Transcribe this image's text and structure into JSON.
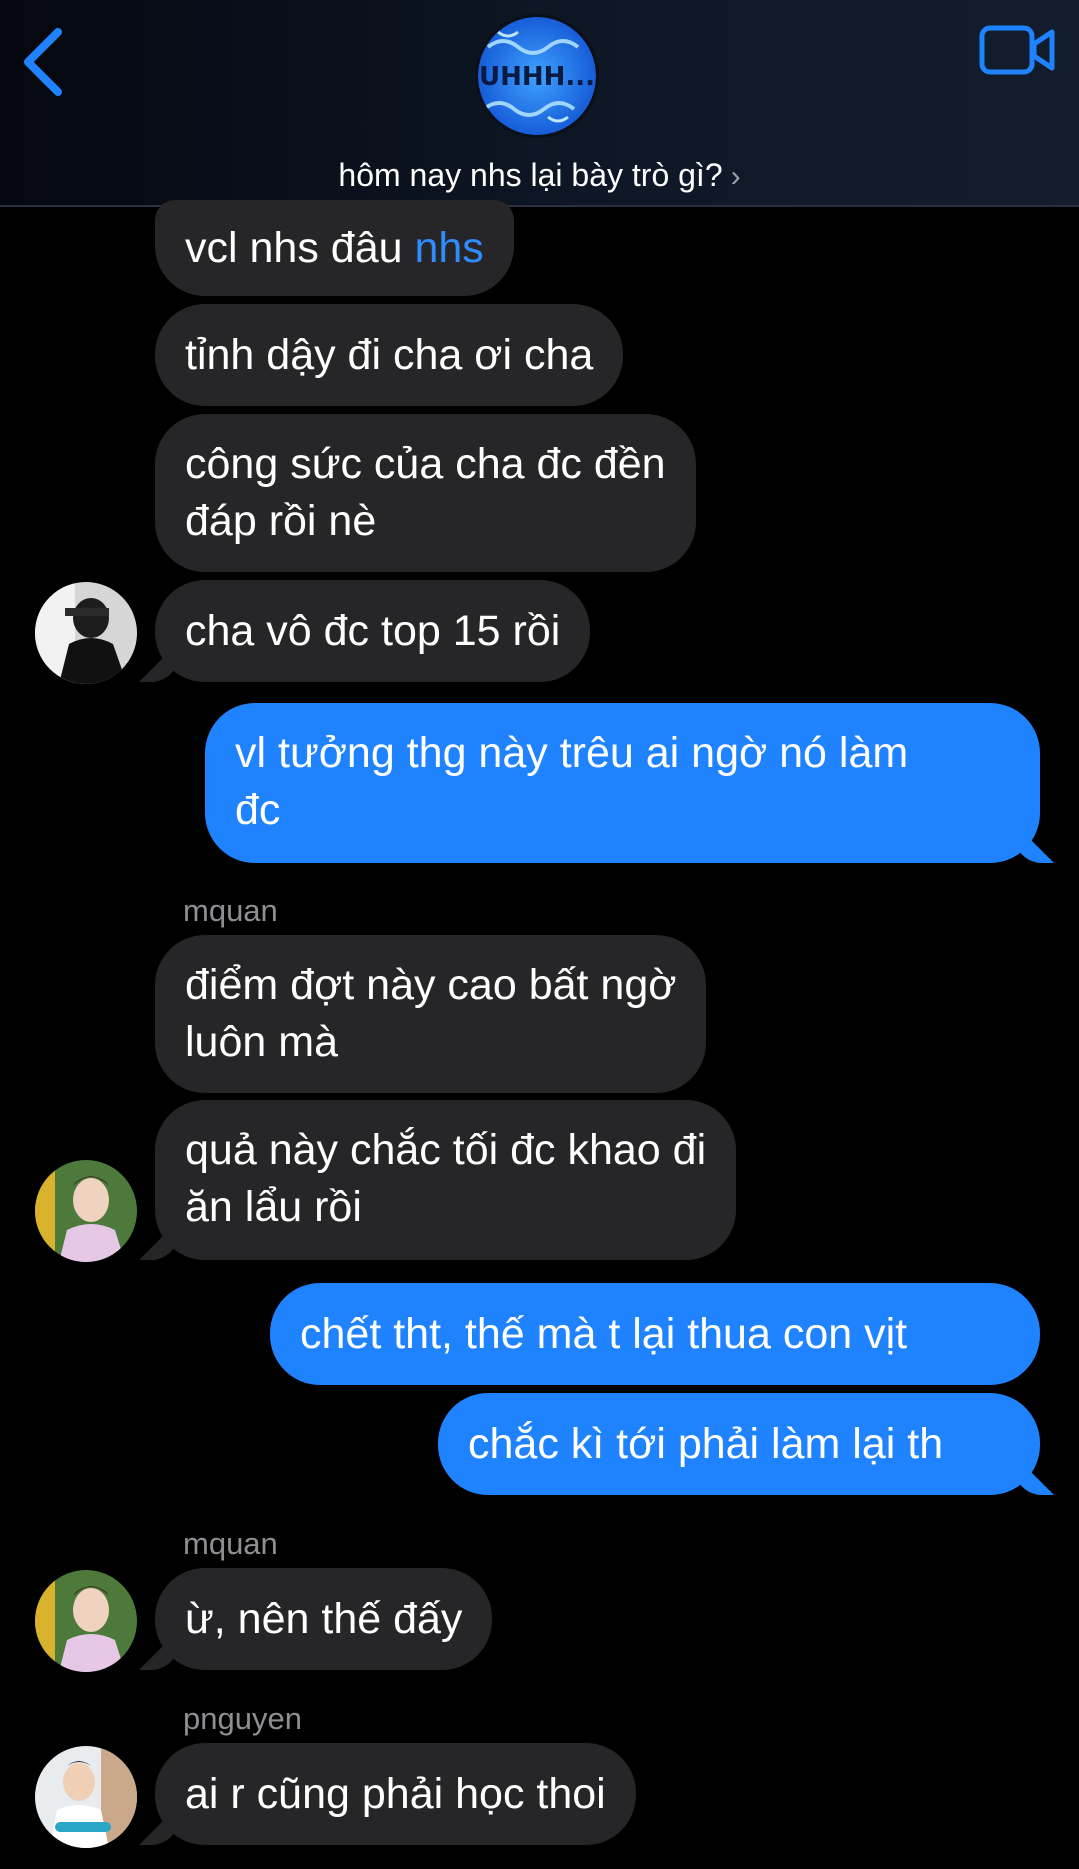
{
  "header": {
    "group_name": "hôm nay nhs lại bày trò gì?",
    "avatar_text": "UHHH...",
    "chevron": "›",
    "back_icon": "chevron-left-icon",
    "video_icon": "video-camera-icon"
  },
  "messages": [
    {
      "text_before": "vcl nhs đâu ",
      "mention": "nhs"
    },
    {
      "text": "tỉnh dậy đi cha ơi cha"
    },
    {
      "line1": "công sức của cha đc đền",
      "line2": "đáp rồi nè"
    },
    {
      "text": "cha vô đc top 15 rồi"
    },
    {
      "line1": "vl tưởng thg này trêu ai ngờ nó làm",
      "line2": "đc"
    },
    {
      "sender": "mquan"
    },
    {
      "line1": "điểm đợt này cao bất ngờ",
      "line2": "luôn mà"
    },
    {
      "line1": "quả này chắc tối đc khao đi",
      "line2": "ăn lẩu rồi"
    },
    {
      "text": "chết tht, thế mà t lại thua con vịt"
    },
    {
      "text": "chắc kì tới phải làm lại th"
    },
    {
      "sender": "mquan"
    },
    {
      "text": "ừ, nên thế đấy"
    },
    {
      "sender": "pnguyen"
    },
    {
      "text": "ai r cũng phải học thoi"
    }
  ],
  "colors": {
    "incoming_bubble": "#262628",
    "outgoing_bubble": "#1f83ff",
    "accent": "#2f8cff",
    "background": "#000000"
  }
}
